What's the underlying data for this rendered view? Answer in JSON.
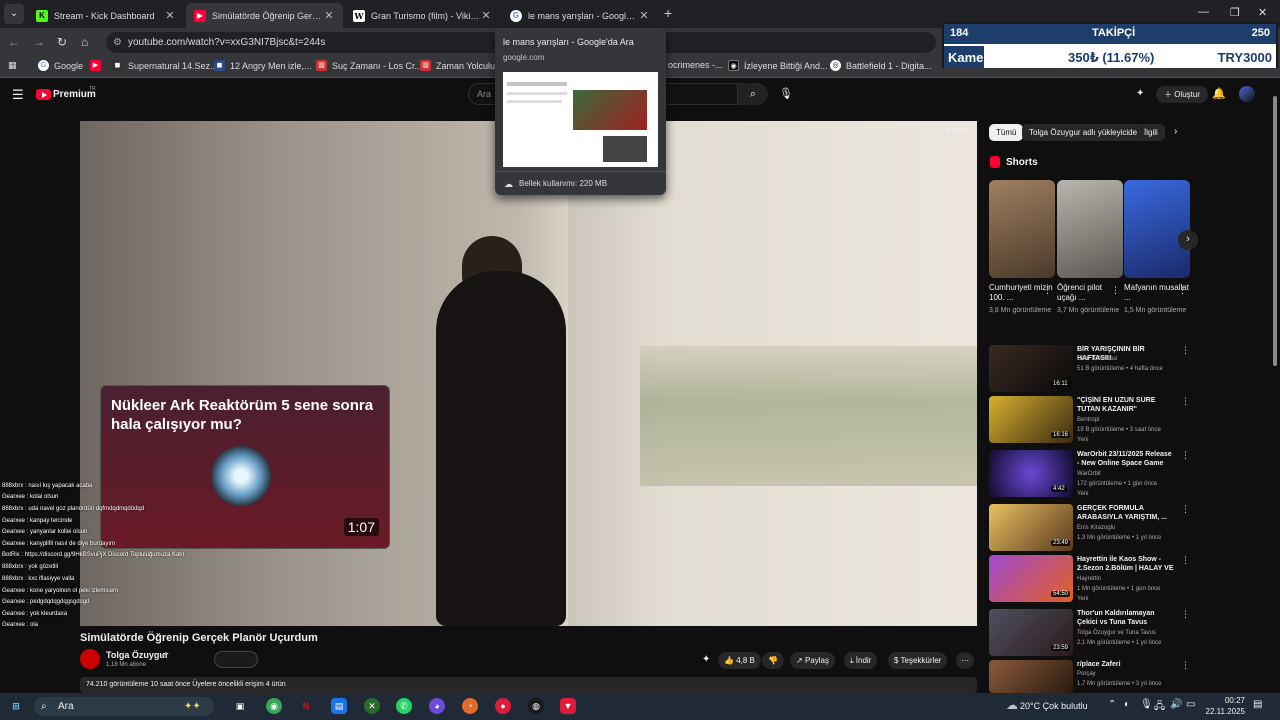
{
  "browser": {
    "tabs": [
      {
        "title": "Stream - Kick Dashboard",
        "favicon": "kick-icon",
        "color": "#53fc18"
      },
      {
        "title": "Simülatörde Öğrenip Gerçek Pl",
        "favicon": "youtube-icon",
        "color": "#ff0033"
      },
      {
        "title": "Gran Turismo (film) - Vikipedi",
        "favicon": "wikipedia-icon",
        "color": "#ffffff"
      },
      {
        "title": "le mans yarışları - Google'da Ar",
        "favicon": "google-icon",
        "color": "#4285f4"
      }
    ],
    "url": "youtube.com/watch?v=xxG3NI7Bjsc&t=244s",
    "bookmarks": [
      "Google",
      "Supernatural 14.Sez...",
      "12 Angry Men izle,...",
      "Suç Zamanı - Los Cr...",
      "Zaman Yolculu",
      "ocrimenes -...",
      "İzleyene Bittiği And...",
      "Battlefield 1 - Digita..."
    ]
  },
  "tab_popup": {
    "title": "le mans yarışları - Google'da Ara",
    "url": "google.com",
    "memory": "Bellek kullanımı: 220 MB"
  },
  "stream_overlay": {
    "count": "184",
    "label": "TAKİPÇİ",
    "goal": "250",
    "camera": "Kamera",
    "amount": "350₺ (11.67%)",
    "target": "TRY3000"
  },
  "youtube": {
    "logo": "Premium",
    "logo_region": "TR",
    "search_placeholder": "Ara",
    "create_label": "Oluştur",
    "hide_label": "Gizle",
    "chips": [
      "Tümü",
      "Tolga Özuygur adlı yükleyiciden",
      "İlgili"
    ],
    "shorts_heading": "Shorts",
    "shorts": [
      {
        "title": "Cumhuriyeti mizin 100. ...",
        "views": "3,8 Mn görüntüleme",
        "color": "#6b5a4a"
      },
      {
        "title": "Öğrenci pilot uçağı ...",
        "views": "3,7 Mn görüntüleme",
        "color": "#8a8a86"
      },
      {
        "title": "Mafyanın musallat ...",
        "views": "1,5 Mn görüntüleme",
        "color": "#2b5bd6"
      }
    ],
    "video": {
      "title": "Simülatörde Öğrenip Gerçek Planör Uçurdum",
      "channel": "Tolga Özuygur",
      "subscribers": "1,18 Mn abone",
      "likes": "4,8 B",
      "share": "Paylaş",
      "download": "İndir",
      "thanks": "Teşekkürler",
      "meta": "74.210 görüntüleme  10 saat önce  Üyelere öncelikli erişim  4 ürün"
    },
    "end_card": {
      "title": "Nükleer Ark Reaktörüm 5 sene sonra hala çalışıyor mu?",
      "duration": "1:07"
    },
    "recommended": [
      {
        "title": "BİR YARIŞÇININ BİR HAFTASI!!",
        "channel": "Cem Bolukbasi",
        "meta": "51 B görüntüleme • 4 hafta önce",
        "badge": "",
        "duration": "16:11",
        "color": "#3a2a20"
      },
      {
        "title": "\"ÇİŞİNİ EN UZUN SÜRE TUTAN KAZANIR\" YARIŞMASI'NIN ...",
        "channel": "Bentropi",
        "meta": "19 B görüntüleme • 3 saat önce",
        "badge": "Yeni",
        "duration": "16:16",
        "color": "#c8a020"
      },
      {
        "title": "WarOrbit 23/11/2025 Release - New Online Space Game Mad...",
        "channel": "WarOrbit",
        "meta": "172 görüntüleme • 1 gün önce",
        "badge": "Yeni",
        "duration": "4:42",
        "color": "#20183a"
      },
      {
        "title": "GERÇEK FORMULA ARABASIYLA YARIŞTIM, ...",
        "channel": "Enis Kirazoglu",
        "meta": "1,3 Mn görüntüleme • 1 yıl önce",
        "badge": "",
        "duration": "23:49",
        "color": "#5a3a20"
      },
      {
        "title": "Hayrettin ile Kaos Show - 2.Sezon 2.Bölüm | HALAY VE ...",
        "channel": "Hayrettin",
        "meta": "1 Mn görüntüleme • 1 gün önce",
        "badge": "Yeni",
        "duration": "54:50",
        "color": "#6a2a8a"
      },
      {
        "title": "Thor'un Kaldırılamayan Çekici vs Tuna Tavus (Mıknatıslı Değil)",
        "channel": "Tolga Özuygur ve Tuna Tavus",
        "meta": "2,1 Mn görüntüleme • 1 yıl önce",
        "badge": "",
        "duration": "23:59",
        "color": "#3a3030"
      },
      {
        "title": "r/place Zaferi",
        "channel": "Porçay",
        "meta": "1,7 Mn görüntüleme • 3 yıl önce",
        "badge": "",
        "duration": "",
        "color": "#4a3020"
      }
    ]
  },
  "chat": [
    "888xbrx : nasıl kış yapacak acaba",
    "Gearxee : kolai olsun",
    "888xbrx : uda navel goz planördün dqfmdqdmqdödqd",
    "Gearxee : kanpay tercinde",
    "Gearxee : yanyanlar kollei olsun",
    "Gearxee : kanyplifil nasıl de diye burdayım",
    "BotRix : https://discord.gg/9HkBSvuPjX Discord Topluluğumuza Katıl",
    "888xbrx : yok gözetlil",
    "888xbrx : kxc iflasiyye valla",
    "Gearxee : kone yaryolnon ol peki izlemicem",
    "Gearxee : pedgdqdqgdqgsgdsgd",
    "Gearxee : yok kleurdaxa",
    "Gearxee : ola"
  ],
  "taskbar": {
    "search": "Ara",
    "weather": "20°C  Çok bulutlu",
    "time": "00:27",
    "date": "22.11.2025"
  }
}
